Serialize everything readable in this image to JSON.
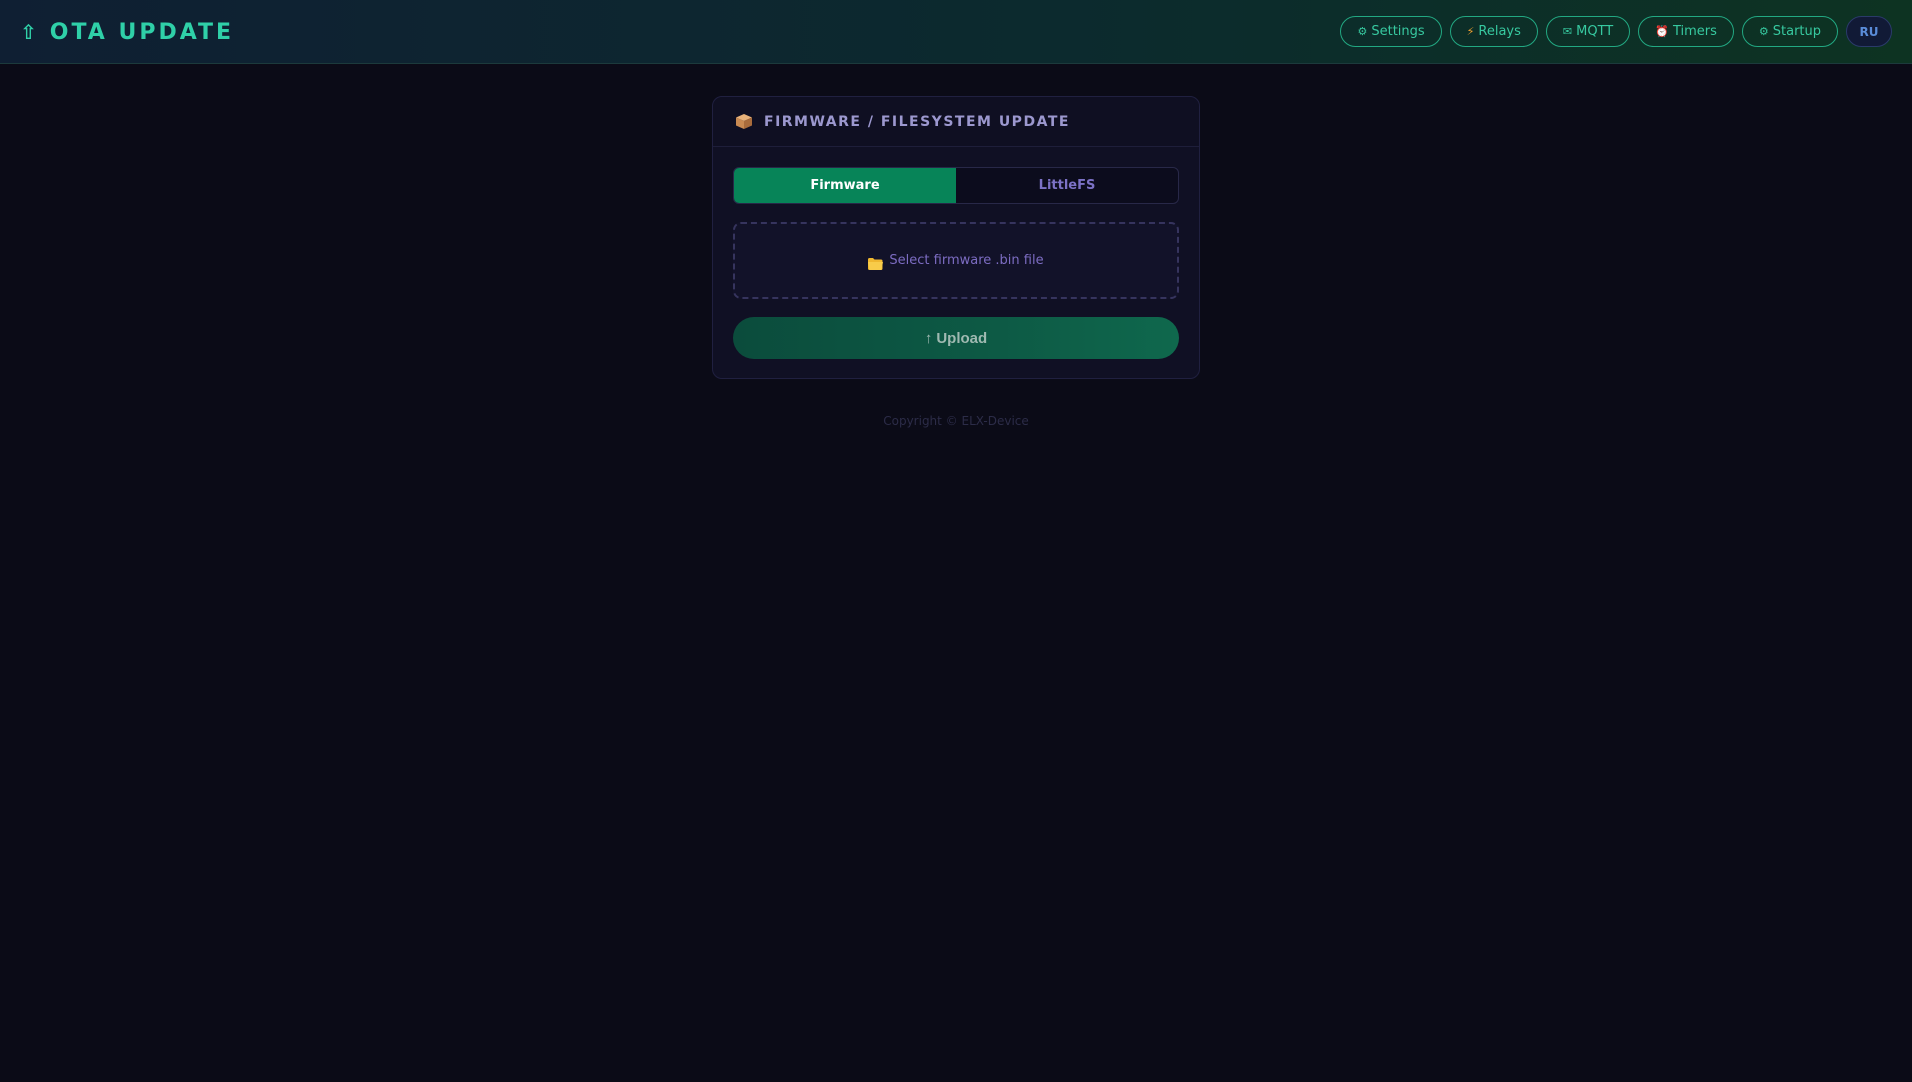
{
  "header": {
    "brand_icon": "upload-arrow-icon",
    "title": "OTA UPDATE",
    "nav": [
      {
        "icon": "gear-icon",
        "glyph": "⚙",
        "label": "Settings"
      },
      {
        "icon": "lightning-icon",
        "glyph": "⚡",
        "label": "Relays"
      },
      {
        "icon": "envelope-icon",
        "glyph": "✉",
        "label": "MQTT"
      },
      {
        "icon": "alarm-clock-icon",
        "glyph": "⏰",
        "label": "Timers"
      },
      {
        "icon": "gear-icon",
        "glyph": "⚙",
        "label": "Startup"
      }
    ],
    "language": "RU"
  },
  "card": {
    "icon": "package-icon",
    "title": "FIRMWARE / FILESYSTEM UPDATE",
    "tabs": [
      {
        "label": "Firmware",
        "active": true
      },
      {
        "label": "LittleFS",
        "active": false
      }
    ],
    "file_picker": {
      "icon": "folder-icon",
      "label": "Select firmware .bin file"
    },
    "upload_button": {
      "icon": "up-arrow-icon",
      "glyph": "↑",
      "label": "Upload"
    }
  },
  "footer": {
    "text": "Copyright © ELX-Device"
  },
  "colors": {
    "background": "#0b0b17",
    "accent": "#078458",
    "brand_text": "#2fd0a8",
    "card_title": "#9c98cf"
  }
}
